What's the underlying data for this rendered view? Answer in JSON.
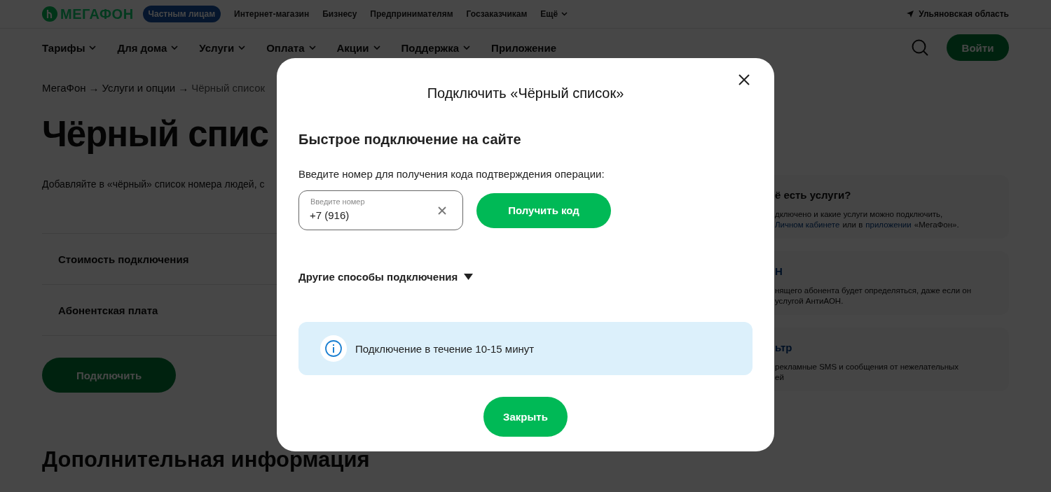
{
  "header": {
    "logo": "МЕГАФОН",
    "segments": [
      {
        "label": "Частным лицам",
        "selected": true
      },
      {
        "label": "Интернет-магазин",
        "selected": false
      },
      {
        "label": "Бизнесу",
        "selected": false
      },
      {
        "label": "Предпринимателям",
        "selected": false
      },
      {
        "label": "Госзаказчикам",
        "selected": false
      }
    ],
    "more": "Ещё",
    "region": "Ульяновская область"
  },
  "nav": {
    "items": [
      {
        "label": "Тарифы",
        "dropdown": true
      },
      {
        "label": "Для дома",
        "dropdown": true
      },
      {
        "label": "Услуги",
        "dropdown": true
      },
      {
        "label": "Оплата",
        "dropdown": true
      },
      {
        "label": "Акции",
        "dropdown": true
      },
      {
        "label": "Поддержка",
        "dropdown": true
      },
      {
        "label": "Приложение",
        "dropdown": false
      }
    ],
    "login": "Войти"
  },
  "breadcrumbs": {
    "separator": "→",
    "items": [
      {
        "label": "МегаФон",
        "current": false
      },
      {
        "label": "Услуги и опции",
        "current": false
      },
      {
        "label": "Чёрный список",
        "current": true
      }
    ]
  },
  "page": {
    "title": "Чёрный спис",
    "intro": "Добавляйте в «чёрный» список номера людей, с",
    "rows": [
      "Стоимость подключения",
      "Абонентская плата"
    ],
    "connect_button": "Подключить",
    "section_title": "Дополнительная информация"
  },
  "cards": [
    {
      "title": "ё есть услуги?",
      "link": false,
      "lines": [
        [
          {
            "text": "дключено и какие услуги можно подключить,",
            "link": false
          }
        ],
        [
          {
            "text": "Личном кабинете",
            "link": true
          },
          {
            "text": "или в",
            "link": false
          },
          {
            "text": "приложении",
            "link": true
          },
          {
            "text": "«МегаФон».",
            "link": false
          }
        ]
      ]
    },
    {
      "title": "Н",
      "link": true,
      "lines": [
        [
          {
            "text": "нящего абонента будет определяться, даже если он",
            "link": false
          }
        ],
        [
          {
            "text": "услугой АнтиАОН.",
            "link": false
          }
        ]
      ]
    },
    {
      "title": "ьтр",
      "link": true,
      "lines": [
        [
          {
            "text": "рекламные SMS и сообщения от нежелательных",
            "link": false
          }
        ],
        [
          {
            "text": "ей",
            "link": false
          }
        ]
      ]
    }
  ],
  "modal": {
    "title": "Подключить «Чёрный список»",
    "heading": "Быстрое подключение на сайте",
    "prompt": "Введите номер для получения кода подтверждения операции:",
    "phone": {
      "label": "Введите номер",
      "value": "+7 (916)"
    },
    "get_code": "Получить код",
    "other_methods": {
      "label": "Другие способы подключения",
      "expanded": false
    },
    "info": "Подключение в течение 10-15 минут",
    "close_button": "Закрыть"
  }
}
